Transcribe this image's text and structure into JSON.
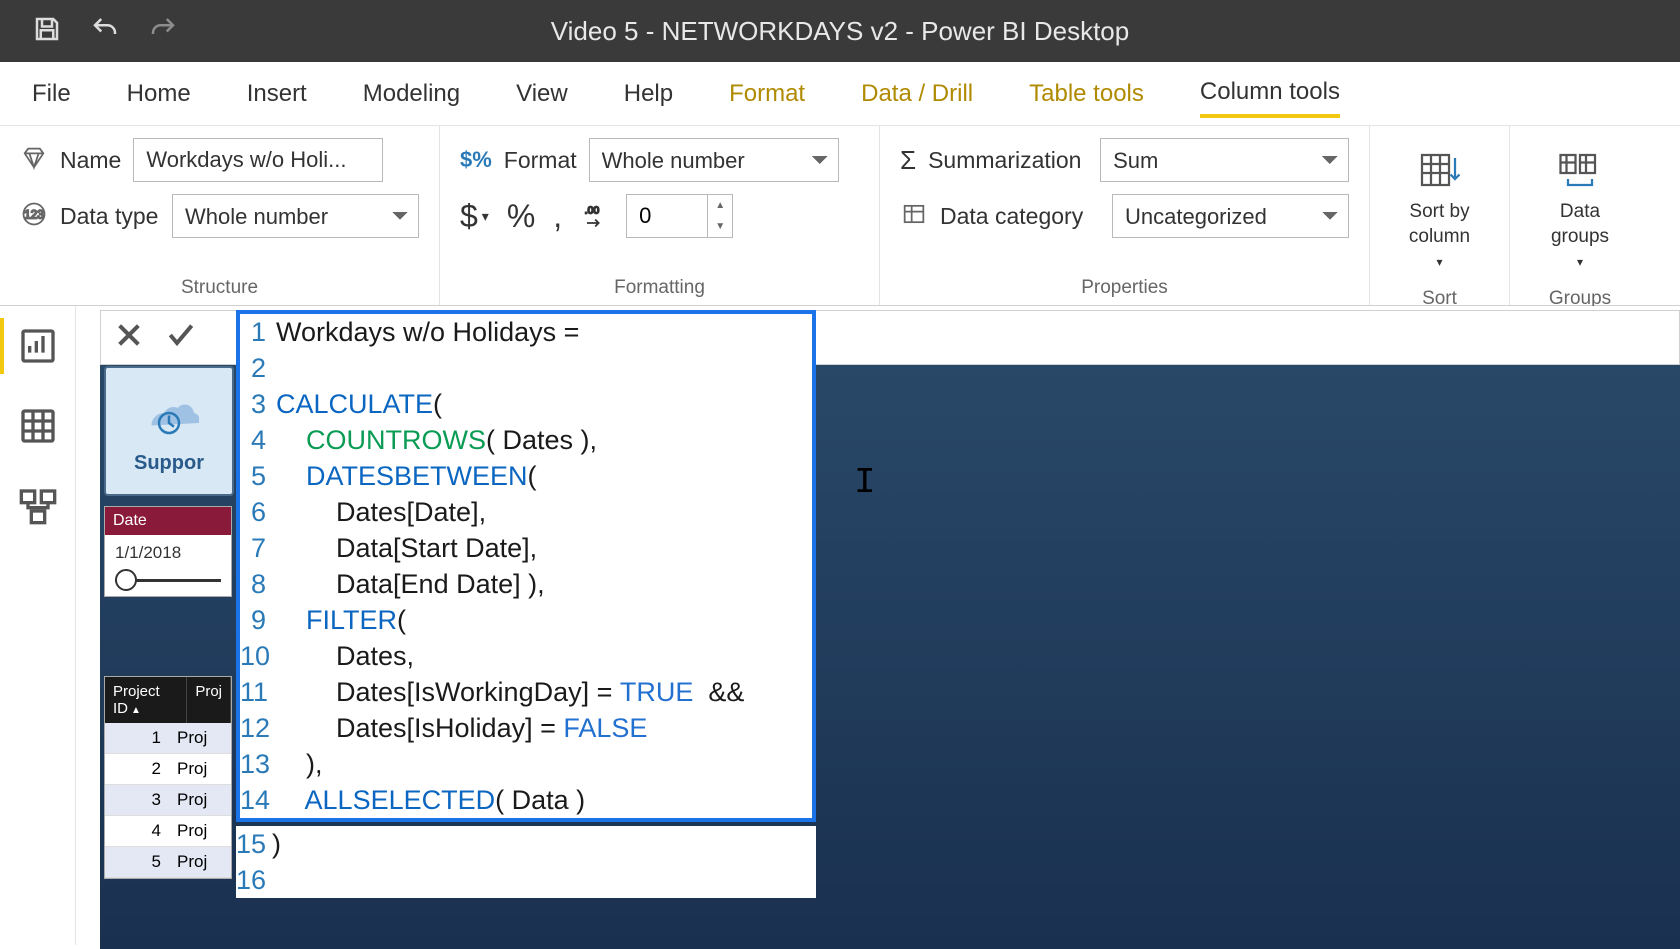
{
  "titlebar": {
    "title": "Video 5 - NETWORKDAYS v2 - Power BI Desktop"
  },
  "tabs": [
    "File",
    "Home",
    "Insert",
    "Modeling",
    "View",
    "Help",
    "Format",
    "Data / Drill",
    "Table tools",
    "Column tools"
  ],
  "activeTab": "Column tools",
  "ribbon": {
    "structure": {
      "label": "Structure",
      "name_label": "Name",
      "name_value": "Workdays w/o Holi...",
      "datatype_label": "Data type",
      "datatype_value": "Whole number"
    },
    "formatting": {
      "label": "Formatting",
      "format_label": "Format",
      "format_value": "Whole number",
      "decimals": "0"
    },
    "properties": {
      "label": "Properties",
      "summarization_label": "Summarization",
      "summarization_value": "Sum",
      "datacategory_label": "Data category",
      "datacategory_value": "Uncategorized"
    },
    "sort": {
      "label": "Sort",
      "button": "Sort by\ncolumn"
    },
    "groups": {
      "label": "Groups",
      "button": "Data\ngroups"
    }
  },
  "editor": {
    "lines": [
      {
        "n": "1",
        "segs": [
          {
            "t": "Workdays w/o Holidays = "
          }
        ]
      },
      {
        "n": "2",
        "segs": [
          {
            "t": ""
          }
        ]
      },
      {
        "n": "3",
        "segs": [
          {
            "t": "CALCULATE",
            "c": "kw1"
          },
          {
            "t": "("
          }
        ]
      },
      {
        "n": "4",
        "segs": [
          {
            "t": "    "
          },
          {
            "t": "COUNTROWS",
            "c": "kw2"
          },
          {
            "t": "( Dates ),"
          }
        ]
      },
      {
        "n": "5",
        "segs": [
          {
            "t": "    "
          },
          {
            "t": "DATESBETWEEN",
            "c": "kw1"
          },
          {
            "t": "("
          }
        ]
      },
      {
        "n": "6",
        "segs": [
          {
            "t": "        Dates[Date],"
          }
        ]
      },
      {
        "n": "7",
        "segs": [
          {
            "t": "        Data[Start Date],"
          }
        ]
      },
      {
        "n": "8",
        "segs": [
          {
            "t": "        Data[End Date] ),"
          }
        ]
      },
      {
        "n": "9",
        "segs": [
          {
            "t": "    "
          },
          {
            "t": "FILTER",
            "c": "kw1"
          },
          {
            "t": "("
          }
        ]
      },
      {
        "n": "10",
        "segs": [
          {
            "t": "        Dates,"
          }
        ]
      },
      {
        "n": "11",
        "segs": [
          {
            "t": "        Dates[IsWorkingDay] = "
          },
          {
            "t": "TRUE",
            "c": "bool"
          },
          {
            "t": "  &&"
          }
        ]
      },
      {
        "n": "12",
        "segs": [
          {
            "t": "        Dates[IsHoliday] = "
          },
          {
            "t": "FALSE",
            "c": "bool"
          }
        ]
      },
      {
        "n": "13",
        "segs": [
          {
            "t": "    ),"
          }
        ]
      },
      {
        "n": "14",
        "segs": [
          {
            "t": "    "
          },
          {
            "t": "ALLSELECTED",
            "c": "kw1"
          },
          {
            "t": "( Data )"
          }
        ]
      }
    ],
    "extra_lines": [
      {
        "n": "15",
        "segs": [
          {
            "t": ")"
          }
        ]
      },
      {
        "n": "16",
        "segs": [
          {
            "t": ""
          }
        ]
      }
    ]
  },
  "viz": {
    "support_tile": "Suppor",
    "date_slicer": {
      "header": "Date",
      "value": "1/1/2018"
    },
    "table": {
      "headers": [
        "Project ID",
        "Proj"
      ],
      "rows": [
        {
          "id": "1",
          "name": "Proj"
        },
        {
          "id": "2",
          "name": "Proj"
        },
        {
          "id": "3",
          "name": "Proj"
        },
        {
          "id": "4",
          "name": "Proj"
        },
        {
          "id": "5",
          "name": "Proj"
        }
      ]
    }
  }
}
